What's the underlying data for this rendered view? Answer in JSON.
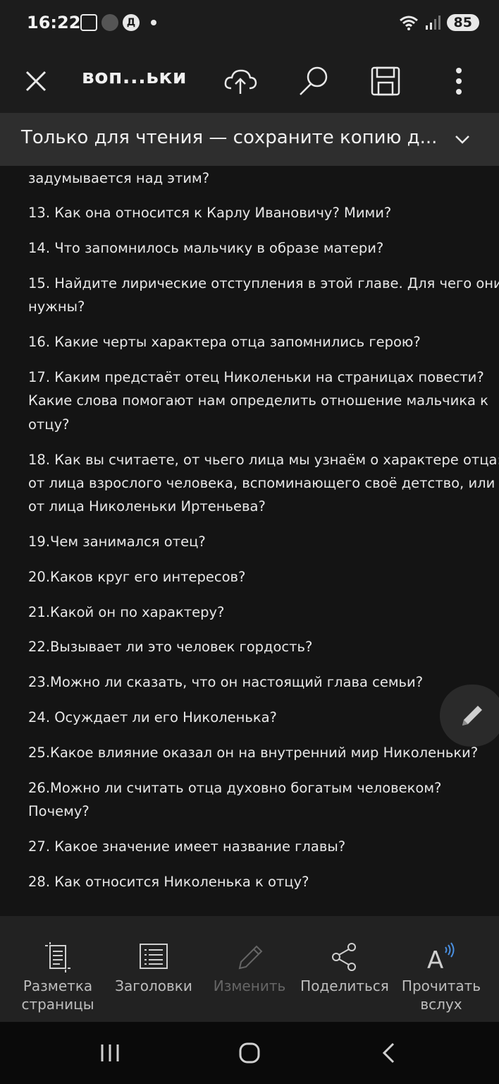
{
  "status_bar": {
    "time": "16:22",
    "notif_letter": "Д",
    "battery": "85",
    "signal_label": "5"
  },
  "toolbar": {
    "title": "воп...ьки",
    "icons": [
      "close-icon",
      "cloud-upload-icon",
      "search-icon",
      "save-icon",
      "more-icon"
    ]
  },
  "banner": {
    "text": "Только для чтения — сохраните копию д..."
  },
  "content": {
    "lines": [
      "задумывается над этим?",
      "13. Как она относится к Карлу Ивановичу? Мими?",
      "14. Что запомнилось мальчику в образе матери?",
      "15. Найдите лирические отступления в этой главе. Для чего они",
      "нужны?",
      "16. Какие черты характера отца запомнились герою?",
      "17. Каким предстаёт отец Николеньки  на страницах повести?",
      "Какие слова помогают нам определить отношение мальчика к",
      "отцу?",
      "18. Как вы считаете, от чьего лица мы узнаём о характере отца:",
      "от лица взрослого человека, вспоминающего своё детство, или",
      "от лица Николеньки Иртеньева?",
      "19.Чем занимался отец?",
      "20.Каков круг его интересов?",
      "21.Какой он по характеру?",
      "22.Вызывает ли это человек гордость?",
      "23.Можно ли сказать, что он настоящий глава семьи?",
      "24. Осуждает ли его Николенька?",
      "25.Какое влияние оказал он на внутренний мир Николеньки?",
      "26.Можно  ли считать отца духовно богатым человеком?",
      "Почему?",
      "27. Какое значение имеет название главы?",
      "28. Как относится  Николенька к отцу?"
    ]
  },
  "bottom_bar": {
    "items": [
      {
        "line1": "Разметка",
        "line2": "страницы",
        "icon": "page-layout-icon",
        "enabled": true
      },
      {
        "line1": "Заголовки",
        "line2": "",
        "icon": "headings-icon",
        "enabled": true
      },
      {
        "line1": "Изменить",
        "line2": "",
        "icon": "pencil-icon",
        "enabled": false
      },
      {
        "line1": "Поделиться",
        "line2": "",
        "icon": "share-icon",
        "enabled": true
      },
      {
        "line1": "Прочитать",
        "line2": "вслух",
        "icon": "read-aloud-icon",
        "enabled": true
      }
    ]
  },
  "fab": {
    "icon": "edit-pencil-icon"
  },
  "nav_bar": {
    "icons": [
      "recents-icon",
      "home-icon",
      "back-icon"
    ]
  }
}
